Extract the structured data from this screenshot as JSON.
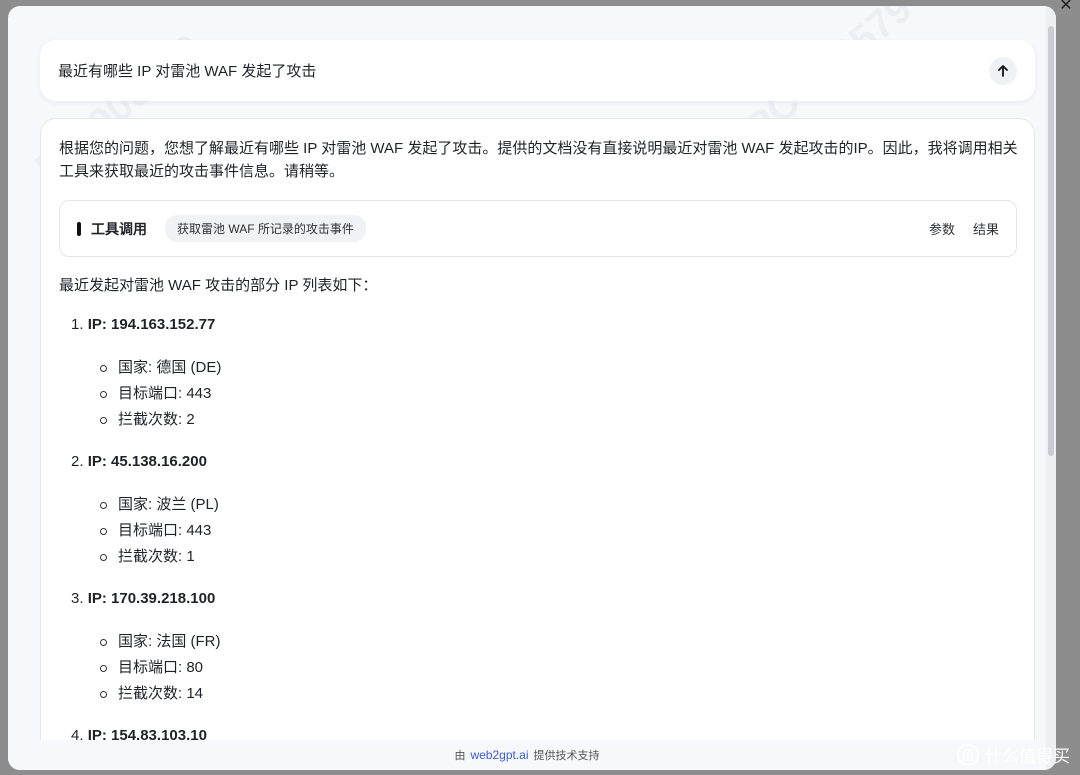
{
  "window": {
    "close_icon": "✕"
  },
  "query": {
    "text": "最近有哪些 IP 对雷池 WAF 发起了攻击",
    "send_icon": "arrow-up-icon"
  },
  "answer": {
    "intro": "根据您的问题，您想了解最近有哪些 IP 对雷池 WAF 发起了攻击。提供的文档没有直接说明最近对雷池 WAF 发起攻击的IP。因此，我将调用相关工具来获取最近的攻击事件信息。请稍等。",
    "tool": {
      "title": "工具调用",
      "chip": "获取雷池 WAF 所记录的攻击事件",
      "params": "参数",
      "result": "结果"
    },
    "list_intro": "最近发起对雷池 WAF 攻击的部分 IP 列表如下：",
    "ips": [
      {
        "num": "1.",
        "ip": "IP: 194.163.152.77",
        "country": "国家: 德国 (DE)",
        "port": "目标端口: 443",
        "blocks": "拦截次数: 2"
      },
      {
        "num": "2.",
        "ip": "IP: 45.138.16.200",
        "country": "国家: 波兰 (PL)",
        "port": "目标端口: 443",
        "blocks": "拦截次数: 1"
      },
      {
        "num": "3.",
        "ip": "IP: 170.39.218.100",
        "country": "国家: 法国 (FR)",
        "port": "目标端口: 80",
        "blocks": "拦截次数: 14"
      },
      {
        "num": "4.",
        "ip": "IP: 154.83.103.10"
      }
    ]
  },
  "footer": {
    "prefix": "由",
    "link": "web2gpt.ai",
    "suffix": "提供技术支持"
  },
  "watermark_text": "PC-000579",
  "site_mark": {
    "text": "什么值得买",
    "logo": "值"
  }
}
